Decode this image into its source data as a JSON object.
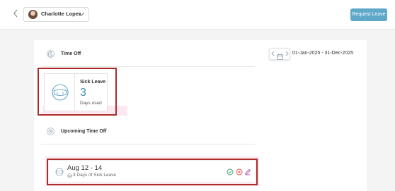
{
  "header": {
    "user_name": "Charlotte Lopez",
    "request_button_label": "Request Leave"
  },
  "time_off": {
    "title": "Time Off",
    "date_range": "01-Jan-2025 - 31-Dec-2025"
  },
  "sick_leave": {
    "title": "Sick Leave",
    "count": "3",
    "unit_label": "Days used"
  },
  "upcoming": {
    "title": "Upcoming Time Off",
    "items": [
      {
        "date": "Aug 12 - 14",
        "detail": "3 Days of Sick Leave"
      }
    ]
  },
  "colors": {
    "accent": "#5fa8c9",
    "count_blue": "#3d8fb5",
    "highlight_border": "#b02a2a",
    "approve_green": "#3aa06b",
    "reject_red": "#d9534f",
    "edit_purple": "#9b59b6"
  },
  "icons": {
    "back": "chevron-left-icon",
    "dropdown": "chevron-down-icon",
    "time_off_section": "moon-icon",
    "upcoming_section": "clock-icon",
    "sick_leave": "sick-face-icon",
    "calendar": "calendar-icon",
    "approve": "check-circle-icon",
    "reject": "x-circle-icon",
    "edit": "pencil-icon"
  }
}
